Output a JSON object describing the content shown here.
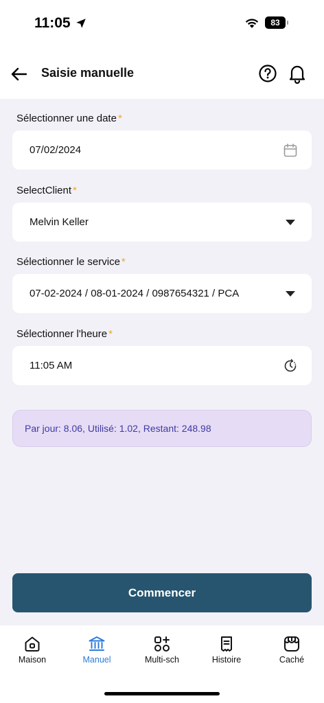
{
  "status_bar": {
    "time": "11:05",
    "battery": "83"
  },
  "header": {
    "title": "Saisie manuelle"
  },
  "form": {
    "date": {
      "label": "Sélectionner une date",
      "required_mark": "*",
      "value": "07/02/2024"
    },
    "client": {
      "label": "SelectClient",
      "required_mark": "*",
      "value": "Melvin Keller"
    },
    "service": {
      "label": "Sélectionner le service",
      "required_mark": "*",
      "value": "07-02-2024 / 08-01-2024 / 0987654321 / PCA"
    },
    "time": {
      "label": "Sélectionner l'heure",
      "required_mark": "*",
      "value": "11:05 AM"
    }
  },
  "info": {
    "text": "Par jour: 8.06, Utilisé: 1.02, Restant: 248.98"
  },
  "start_button": {
    "label": "Commencer"
  },
  "tabs": [
    {
      "label": "Maison",
      "icon": "home-icon",
      "active": false
    },
    {
      "label": "Manuel",
      "icon": "bank-icon",
      "active": true
    },
    {
      "label": "Multi-sch",
      "icon": "grid-plus-icon",
      "active": false
    },
    {
      "label": "Histoire",
      "icon": "document-icon",
      "active": false
    },
    {
      "label": "Caché",
      "icon": "store-icon",
      "active": false
    }
  ],
  "colors": {
    "accent": "#2e7bd9",
    "primary_button": "#27556f",
    "required": "#f5a623",
    "info_bg": "#e6dcf6",
    "info_text": "#3f3aa0"
  }
}
